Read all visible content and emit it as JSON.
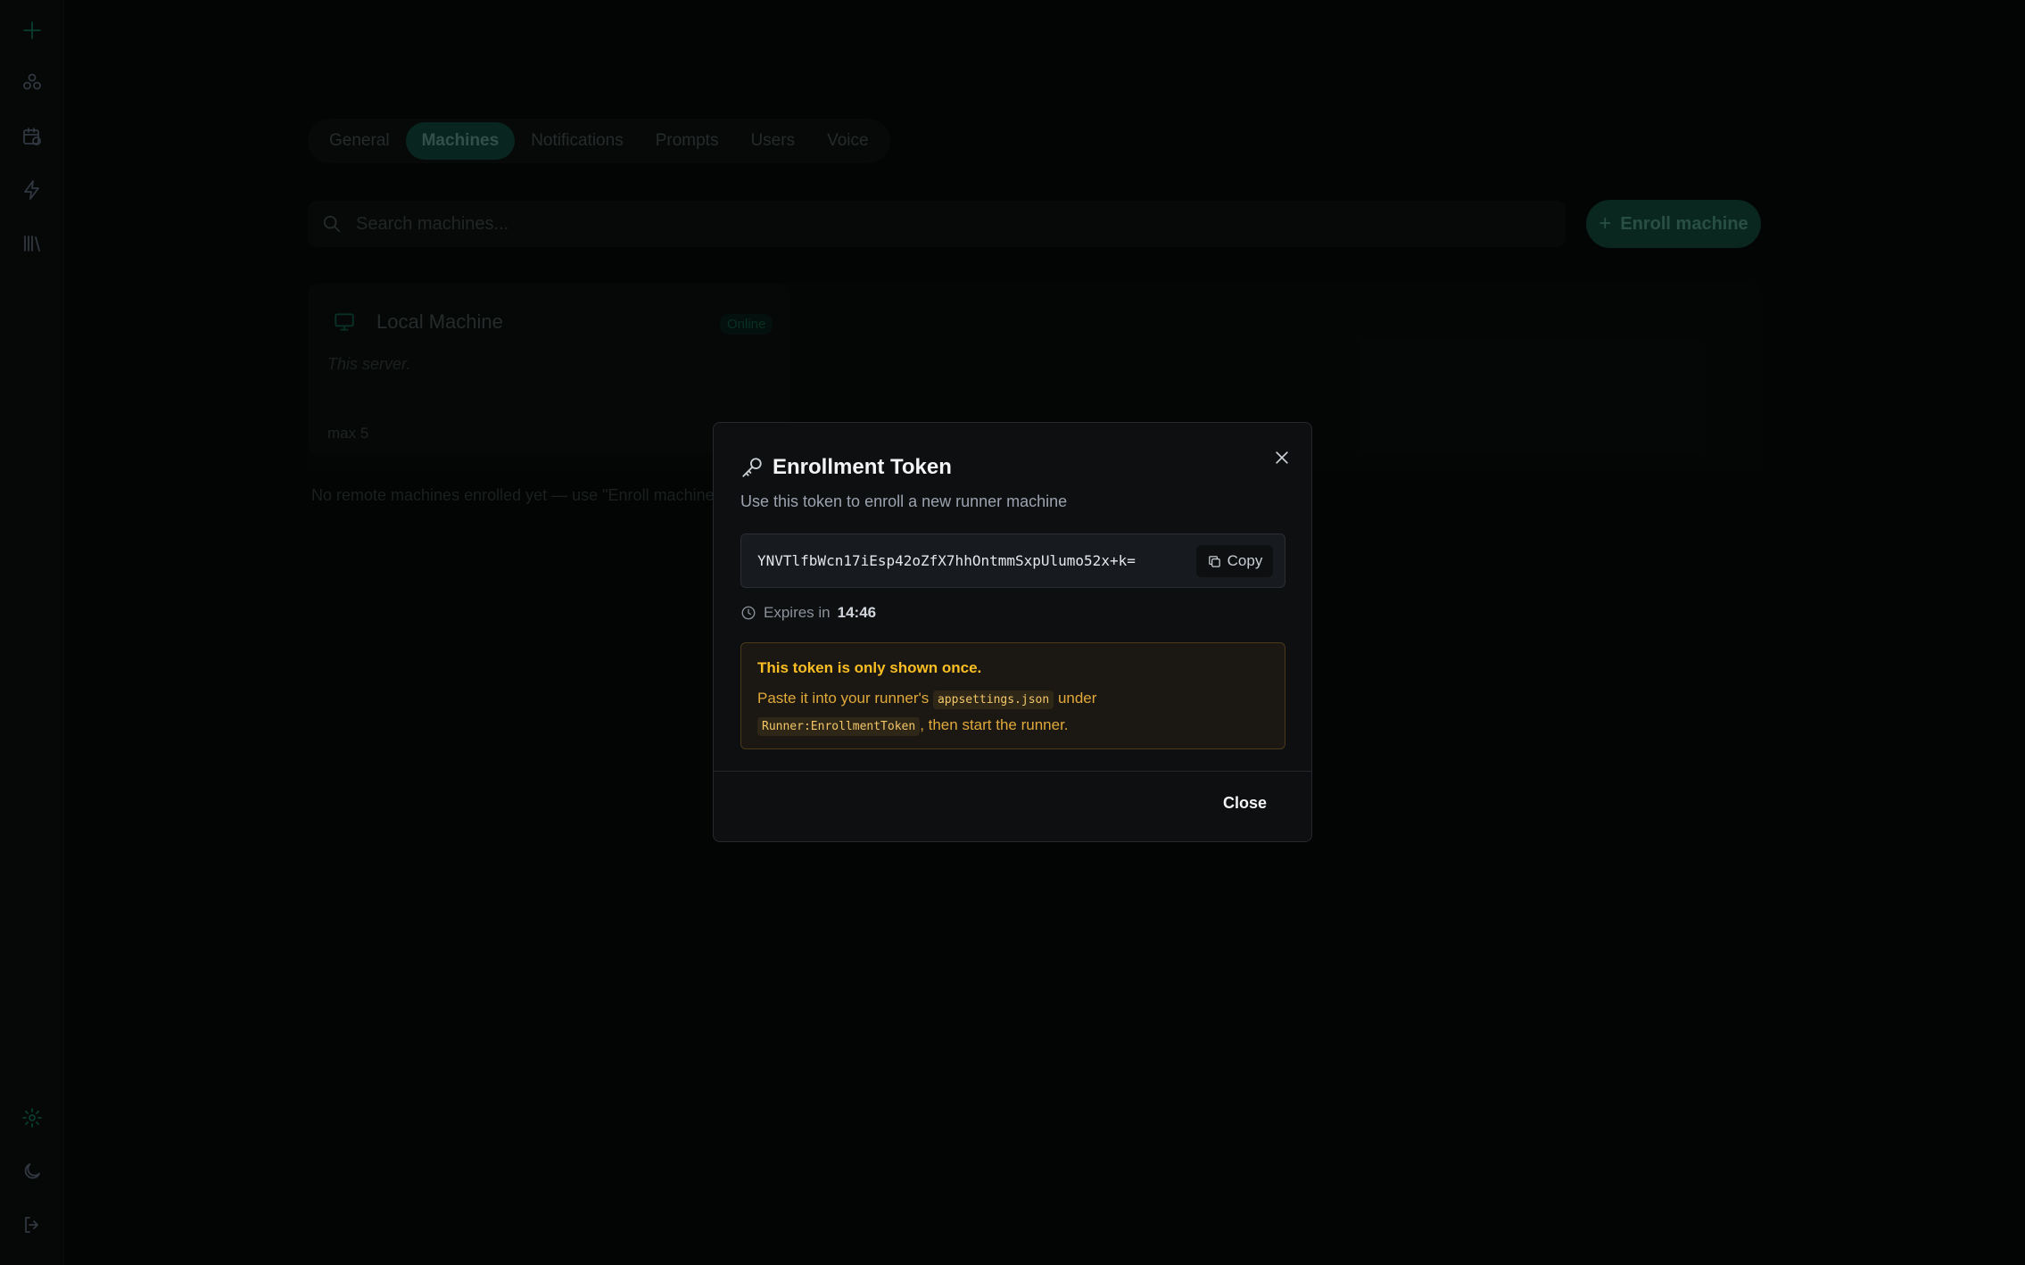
{
  "sidebar": {
    "icons": [
      "logo-icon",
      "cluster-icon",
      "calendar-clock-icon",
      "lightning-icon",
      "library-icon",
      "settings-icon",
      "moon-icon",
      "logout-icon"
    ]
  },
  "tabs": [
    {
      "label": "General",
      "active": false
    },
    {
      "label": "Machines",
      "active": true
    },
    {
      "label": "Notifications",
      "active": false
    },
    {
      "label": "Prompts",
      "active": false
    },
    {
      "label": "Users",
      "active": false
    },
    {
      "label": "Voice",
      "active": false
    }
  ],
  "search": {
    "placeholder": "Search machines..."
  },
  "enroll_button": {
    "label": "Enroll machine"
  },
  "machine_card": {
    "title": "Local Machine",
    "status": "Online",
    "description": "This server.",
    "max": "max 5"
  },
  "empty_note": "No remote machines enrolled yet — use \"Enroll machine\" to a",
  "modal": {
    "title": "Enrollment Token",
    "subtitle": "Use this token to enroll a new runner machine",
    "token": "YNVTlfbWcn17iEsp42oZfX7hhOntmmSxpUlumo52x+k=",
    "copy_label": "Copy",
    "expires_prefix": "Expires in",
    "expires_value": "14:46",
    "warning_title": "This token is only shown once.",
    "warning_text_1": "Paste it into your runner's",
    "warning_code_1": "appsettings.json",
    "warning_text_2": "under",
    "warning_code_2": "Runner:EnrollmentToken",
    "warning_text_3": ", then start the runner.",
    "close_label": "Close"
  },
  "colors": {
    "accent": "#0f3a30",
    "warning": "#fbbf24",
    "modal_bg": "#0d0f11"
  }
}
